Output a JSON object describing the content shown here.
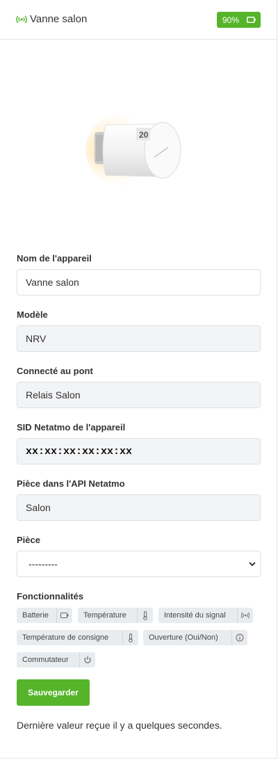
{
  "header": {
    "title": "Vanne salon",
    "signal_icon": "wifi-signal-icon",
    "battery_label": "90%",
    "battery_icon": "battery-icon",
    "accent_color": "#55b42a"
  },
  "device_image": {
    "icon": "netatmo-valve-image"
  },
  "form": {
    "name_label": "Nom de l'appareil",
    "name_value": "Vanne salon",
    "model_label": "Modèle",
    "model_value": "NRV",
    "bridge_label": "Connecté au pont",
    "bridge_value": "Relais Salon",
    "sid_label": "SID Netatmo de l'appareil",
    "sid_value": "xx:xx:xx:xx:xx:xx",
    "api_room_label": "Pièce dans l'API Netatmo",
    "api_room_value": "Salon",
    "room_label": "Pièce",
    "room_selected": "---------"
  },
  "features": {
    "label": "Fonctionnalités",
    "items": [
      {
        "label": "Batterie",
        "icon": "battery-icon"
      },
      {
        "label": "Température",
        "icon": "thermometer-icon"
      },
      {
        "label": "Intensité du signal",
        "icon": "signal-icon"
      },
      {
        "label": "Température de consigne",
        "icon": "thermometer-icon"
      },
      {
        "label": "Ouverture (Oui/Non)",
        "icon": "info-icon"
      },
      {
        "label": "Commutateur",
        "icon": "power-icon"
      }
    ]
  },
  "actions": {
    "save_label": "Sauvegarder"
  },
  "footer": {
    "last_value_text": "Dernière valeur reçue il y a quelques secondes."
  }
}
